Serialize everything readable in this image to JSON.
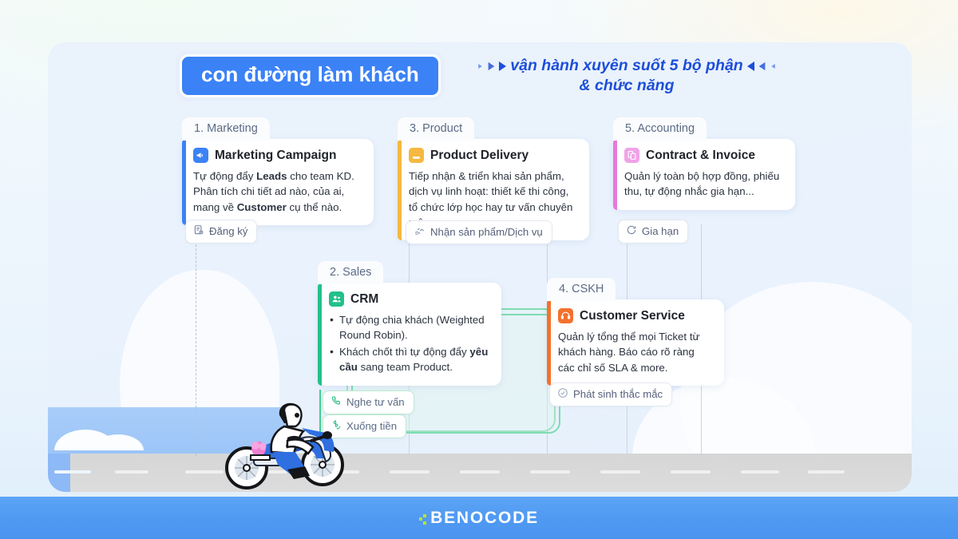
{
  "header": {
    "title": "con đường làm khách",
    "subtitle_line1": "vận hành xuyên suốt 5 bộ phận",
    "subtitle_line2": "& chức năng"
  },
  "colors": {
    "accent_blue": "#3b82f6",
    "subtitle_blue": "#1d4ed8",
    "marketing": "#3b82f6",
    "sales": "#22c08a",
    "product": "#f5b841",
    "cskh": "#f4712e",
    "accounting": "#e879d8",
    "footer": "#4f99f2",
    "brand_dot": "#b7e234"
  },
  "stages": [
    {
      "id": "marketing",
      "tab": "1. Marketing",
      "icon": "megaphone-icon",
      "title": "Marketing Campaign",
      "body_parts": [
        {
          "t": "Tự động đẩy ",
          "b": false
        },
        {
          "t": "Leads",
          "b": true
        },
        {
          "t": " cho team KD. Phân tích chi tiết ad nào, của ai, mang về ",
          "b": false
        },
        {
          "t": "Customer",
          "b": true
        },
        {
          "t": " cụ thể nào.",
          "b": false
        }
      ],
      "bar_color": "#3b82f6"
    },
    {
      "id": "sales",
      "tab": "2. Sales",
      "icon": "users-icon",
      "title": "CRM",
      "bullets": [
        [
          {
            "t": "Tự động chia khách (Weighted Round Robin).",
            "b": false
          }
        ],
        [
          {
            "t": "Khách chốt thì tự động đẩy ",
            "b": false
          },
          {
            "t": "yêu cầu",
            "b": true
          },
          {
            "t": " sang team Product.",
            "b": false
          }
        ]
      ],
      "bar_color": "#22c08a"
    },
    {
      "id": "product",
      "tab": "3. Product",
      "icon": "hand-package-icon",
      "title": "Product Delivery",
      "body_parts": [
        {
          "t": "Tiếp nhận & triển khai sản phẩm, dịch vụ linh hoạt: thiết kế thi công, tổ chức lớp học hay tư vấn chuyên môn...",
          "b": false
        }
      ],
      "bar_color": "#f5b841"
    },
    {
      "id": "cskh",
      "tab": "4. CSKH",
      "icon": "headset-icon",
      "title": "Customer Service",
      "body_parts": [
        {
          "t": "Quản lý tổng thể mọi Ticket từ khách hàng. Báo cáo rõ ràng các chỉ số SLA & more.",
          "b": false
        }
      ],
      "bar_color": "#f4712e"
    },
    {
      "id": "accounting",
      "tab": "5. Accounting",
      "icon": "invoice-icon",
      "title": "Contract & Invoice",
      "body_parts": [
        {
          "t": "Quản lý toàn bộ hợp đồng, phiếu thu, tự động nhắc gia hạn...",
          "b": false
        }
      ],
      "bar_color": "#e879d8"
    }
  ],
  "chips": [
    {
      "id": "dang-ky",
      "label": "Đăng ký",
      "icon": "form-register-icon",
      "style": "plain"
    },
    {
      "id": "nhan-san-pham",
      "label": "Nhận sản phẩm/Dịch vụ",
      "icon": "handover-icon",
      "style": "plain"
    },
    {
      "id": "gia-han",
      "label": "Gia hạn",
      "icon": "renew-icon",
      "style": "plain"
    },
    {
      "id": "nghe-tu-van",
      "label": "Nghe tư vấn",
      "icon": "phone-icon",
      "style": "green"
    },
    {
      "id": "xuong-tien",
      "label": "Xuống tiền",
      "icon": "money-check-icon",
      "style": "green"
    },
    {
      "id": "phat-sinh-thac-mac",
      "label": "Phát sinh thắc mắc",
      "icon": "check-circle-icon",
      "style": "plain"
    }
  ],
  "footer": {
    "brand": "BENOCODE"
  }
}
